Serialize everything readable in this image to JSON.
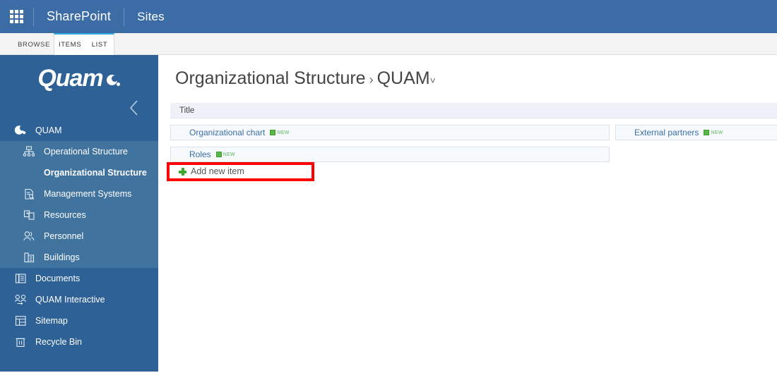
{
  "suitebar": {
    "app_launcher": "app-launcher",
    "brand": "SharePoint",
    "section": "Sites"
  },
  "ribbon": {
    "tabs": [
      {
        "label": "BROWSE",
        "active": false
      },
      {
        "label": "ITEMS",
        "active": true
      },
      {
        "label": "LIST",
        "active": true
      }
    ]
  },
  "sidebar": {
    "logo_text": "Quam",
    "collapse": "collapse-nav",
    "items": [
      {
        "label": "QUAM",
        "icon": "quam-logo-icon",
        "level": "root"
      },
      {
        "label": "Operational Structure",
        "icon": "org-chart-icon",
        "level": "child"
      },
      {
        "label": "Organizational Structure",
        "icon": "",
        "level": "child-selected"
      },
      {
        "label": "Management Systems",
        "icon": "document-search-icon",
        "level": "child"
      },
      {
        "label": "Resources",
        "icon": "resources-icon",
        "level": "child"
      },
      {
        "label": "Personnel",
        "icon": "people-icon",
        "level": "child"
      },
      {
        "label": "Buildings",
        "icon": "building-icon",
        "level": "child"
      },
      {
        "label": "Documents",
        "icon": "documents-icon",
        "level": "root"
      },
      {
        "label": "QUAM Interactive",
        "icon": "interactive-people-icon",
        "level": "root"
      },
      {
        "label": "Sitemap",
        "icon": "sitemap-icon",
        "level": "root"
      },
      {
        "label": "Recycle Bin",
        "icon": "trash-icon",
        "level": "root"
      }
    ]
  },
  "page": {
    "title": "Organizational Structure",
    "separator": "›",
    "site": "QUAM",
    "caret": "˅"
  },
  "list": {
    "column_header": "Title",
    "badge_label": "NEW",
    "rows": [
      {
        "left": "Organizational chart",
        "left_badge": true,
        "right": "External partners",
        "right_badge": true
      },
      {
        "left": "Roles",
        "left_badge": true,
        "right": null,
        "right_badge": false
      }
    ],
    "add_new_label": "Add new item"
  },
  "colors": {
    "suitebar": "#3c6ca5",
    "nav_root": "#2e6196",
    "nav_child": "#41739f",
    "accent_tab": "#2bafe5",
    "link": "#3a6fa5",
    "badge_green": "#57b847",
    "highlight": "#ff0000"
  }
}
